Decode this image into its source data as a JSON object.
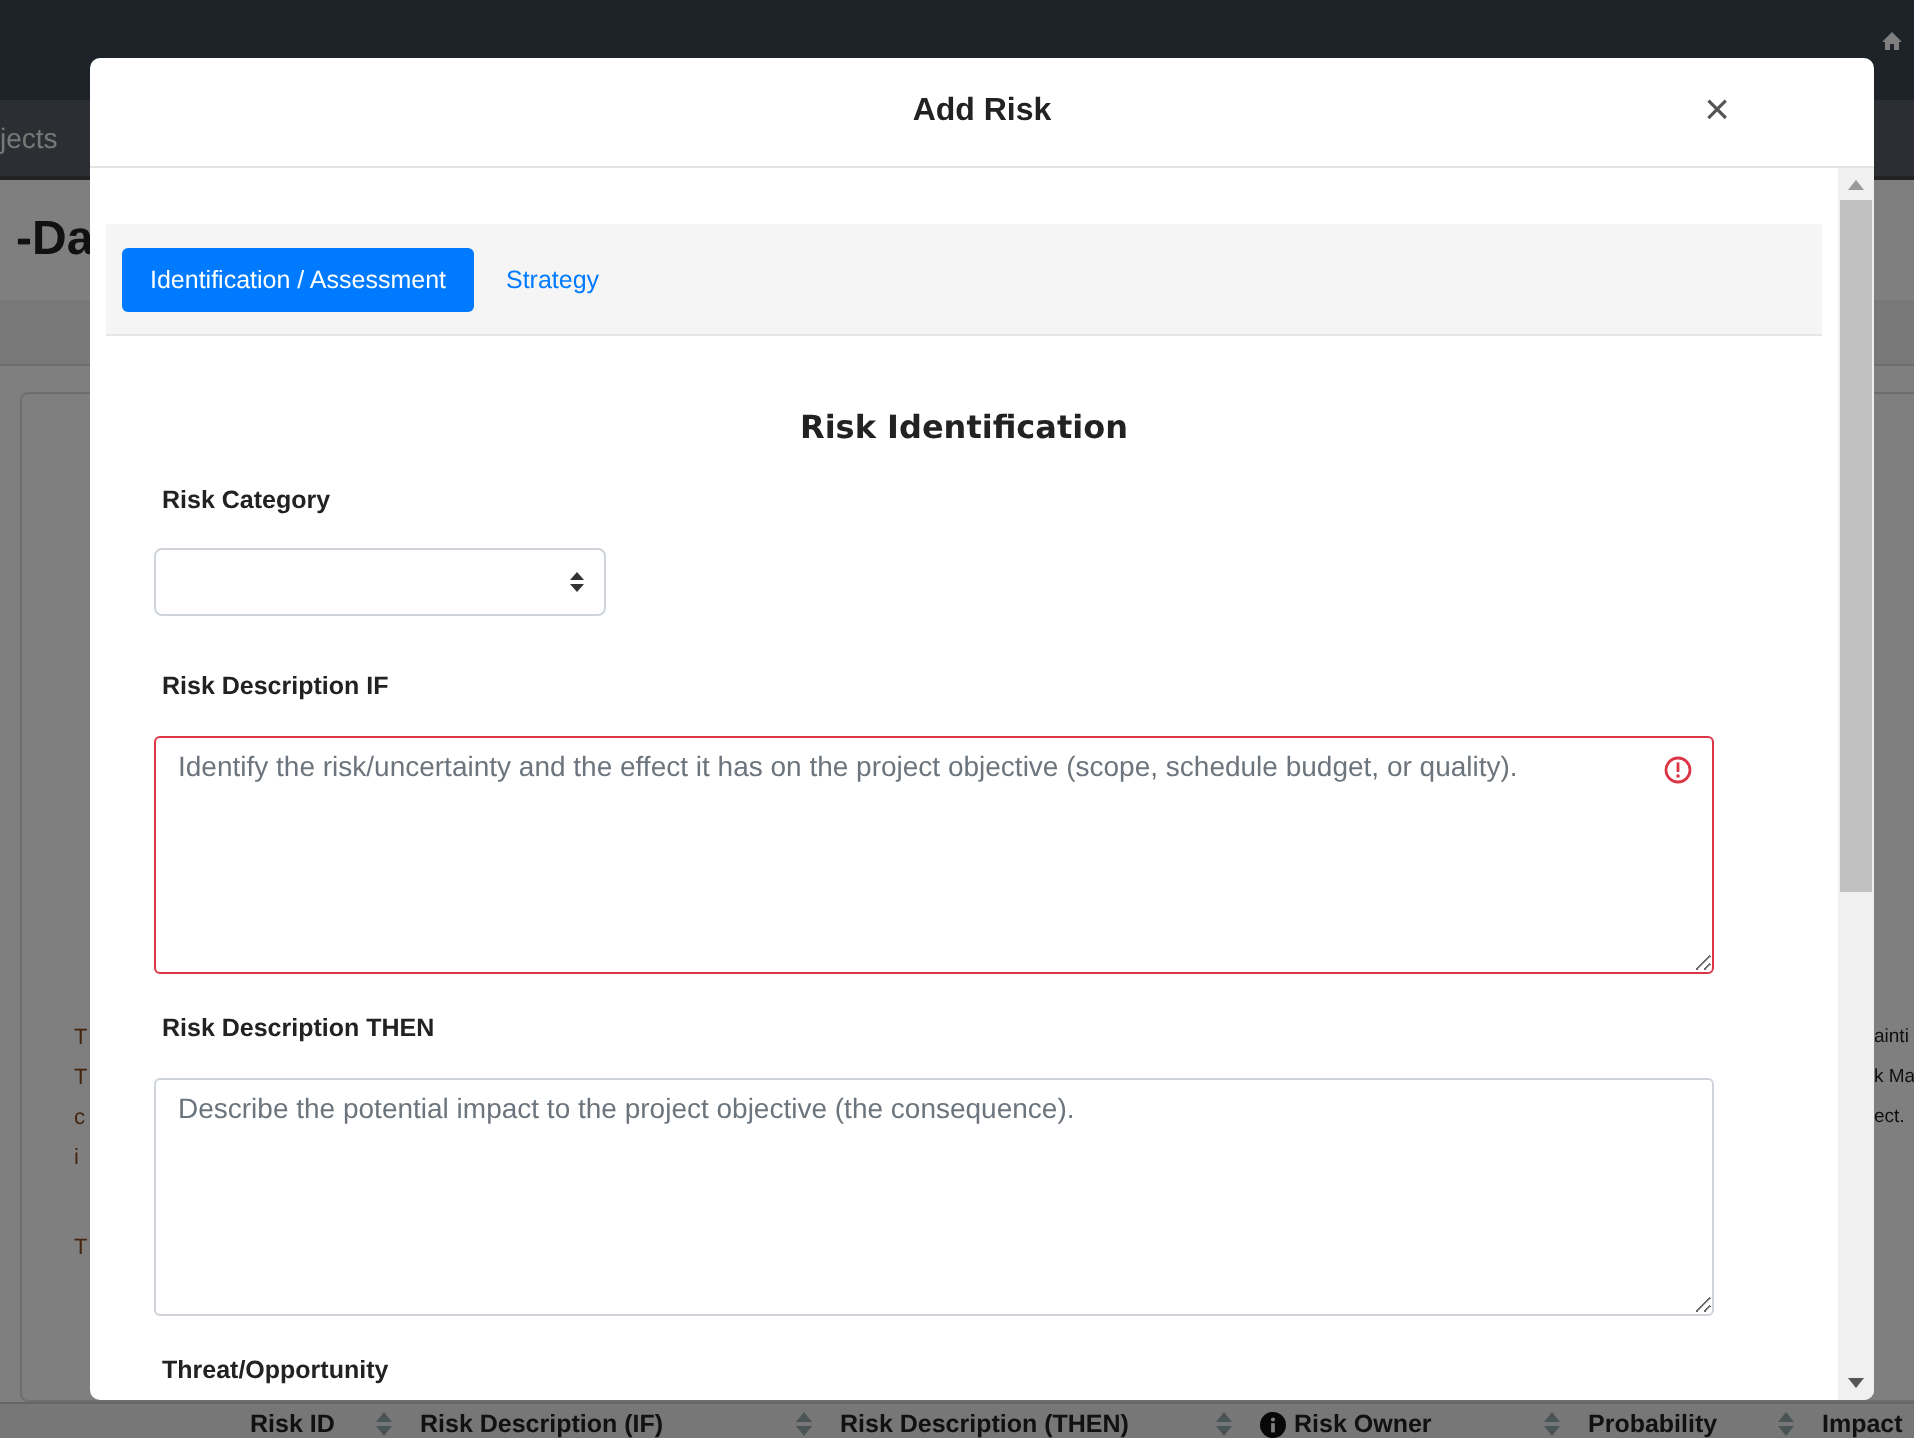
{
  "background_page": {
    "nav_text": "jects",
    "heading": "-Da",
    "left_text": [
      "T",
      "T",
      "c",
      "i",
      "T"
    ],
    "right_text": [
      "ainti",
      "k Ma",
      "ect."
    ],
    "table_columns": [
      {
        "label": "Risk ID",
        "info": false,
        "sortable": true
      },
      {
        "label": "Risk Description (IF)",
        "info": false,
        "sortable": true
      },
      {
        "label": "Risk Description (THEN)",
        "info": false,
        "sortable": true
      },
      {
        "label": "Risk Owner",
        "info": true,
        "sortable": true
      },
      {
        "label": "Probability",
        "info": false,
        "sortable": true
      },
      {
        "label": "Impact",
        "info": false,
        "sortable": false
      }
    ]
  },
  "modal": {
    "title": "Add Risk",
    "close": "×",
    "tabs": [
      {
        "label": "Identification / Assessment",
        "selected": true
      },
      {
        "label": "Strategy",
        "selected": false
      }
    ],
    "section_title": "Risk Identification",
    "fields": [
      {
        "kind": "select",
        "label": "Risk Category"
      },
      {
        "kind": "textarea",
        "label": "Risk Description IF",
        "placeholder": "Identify the risk/uncertainty and the effect it has on the project objective (scope, schedule budget, or quality).",
        "invalid": true
      },
      {
        "kind": "textarea",
        "label": "Risk Description THEN",
        "placeholder": "Describe the potential impact to the project objective (the consequence).",
        "invalid": false
      },
      {
        "kind": "label",
        "label": "Threat/Opportunity"
      }
    ]
  }
}
